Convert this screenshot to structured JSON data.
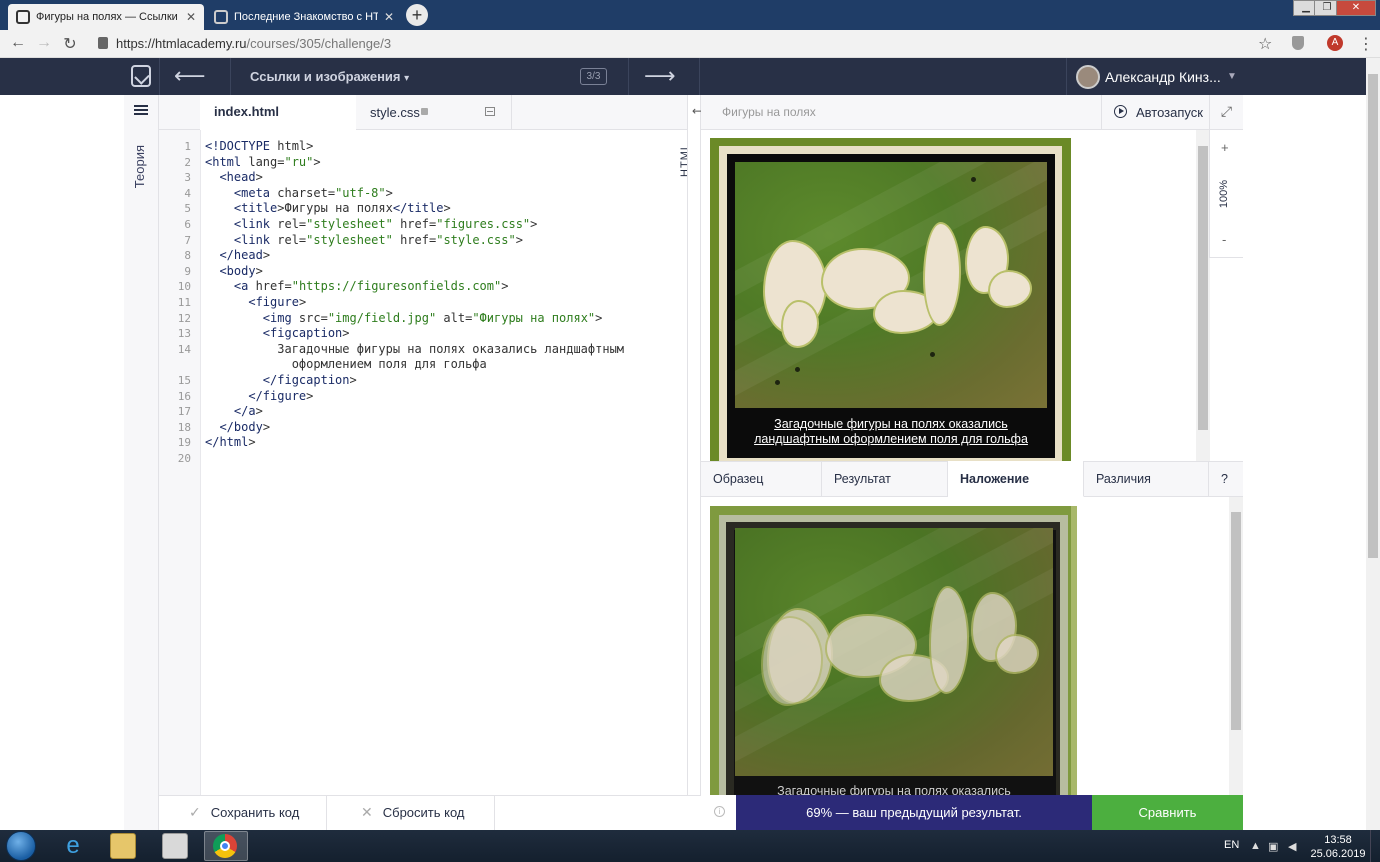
{
  "browser": {
    "tabs": [
      {
        "title": "Фигуры на полях — Ссылки и и",
        "active": true
      },
      {
        "title": "Последние Знакомство с HTML",
        "active": false
      }
    ],
    "url_host": "https://htmlacademy.ru",
    "url_path": "/courses/305/challenge/3",
    "profile_initial": "A"
  },
  "header": {
    "lesson_title": "Ссылки и изображения",
    "counter": "3/3",
    "user_name": "Александр Кинз..."
  },
  "sidebar": {
    "theory_label": "Теория"
  },
  "editor": {
    "tabs": [
      {
        "label": "index.html",
        "active": true
      },
      {
        "label": "style.css",
        "locked": true
      }
    ],
    "mode_label": "HTML",
    "line_numbers": [
      "1",
      "2",
      "3",
      "4",
      "5",
      "6",
      "7",
      "8",
      "9",
      "10",
      "11",
      "12",
      "13",
      "14",
      "",
      "15",
      "16",
      "17",
      "18",
      "19",
      "20"
    ],
    "code_lines": [
      "<!DOCTYPE html>",
      "<html lang=\"ru\">",
      "  <head>",
      "    <meta charset=\"utf-8\">",
      "    <title>Фигуры на полях</title>",
      "    <link rel=\"stylesheet\" href=\"figures.css\">",
      "    <link rel=\"stylesheet\" href=\"style.css\">",
      "  </head>",
      "  <body>",
      "    <a href=\"https://figuresonfields.com\">",
      "      <figure>",
      "        <img src=\"img/field.jpg\" alt=\"Фигуры на полях\">",
      "        <figcaption>",
      "          Загадочные фигуры на полях оказались ландшафтным",
      "            оформлением поля для гольфа",
      "        </figcaption>",
      "      </figure>",
      "    </a>",
      "  </body>",
      "</html>",
      ""
    ]
  },
  "preview": {
    "title": "Фигуры на полях",
    "autorun_label": "Автозапуск",
    "zoom_level": "100%",
    "zoom_in": "+",
    "zoom_out": "-",
    "caption_line1": "Загадочные фигуры на полях оказались",
    "caption_line2": "ландшафтным оформлением поля для гольфа"
  },
  "compare": {
    "tabs": [
      {
        "label": "Образец"
      },
      {
        "label": "Результат"
      },
      {
        "label": "Наложение",
        "active": true
      },
      {
        "label": "Различия"
      },
      {
        "label": "?"
      }
    ],
    "overlay_caption": "Загадочные фигуры на полях оказались"
  },
  "footer": {
    "save_label": "Сохранить код",
    "reset_label": "Сбросить код",
    "result_text": "69% — ваш предыдущий результат.",
    "compare_label": "Сравнить"
  },
  "taskbar": {
    "lang": "EN",
    "time": "13:58",
    "date": "25.06.2019"
  },
  "colors": {
    "header_bg": "#283046",
    "result_bg": "#2c2a78",
    "compare_bg": "#4caf3f",
    "frame_green": "#6b8a27"
  }
}
